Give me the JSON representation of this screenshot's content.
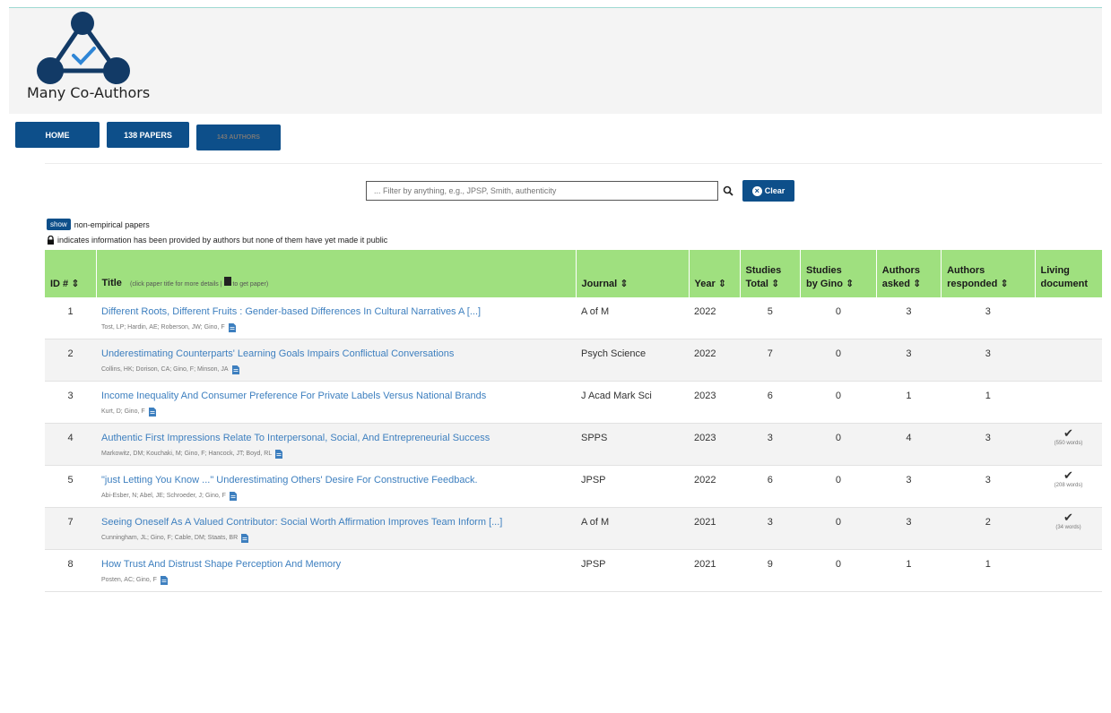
{
  "brand": {
    "name": "Many Co-Authors"
  },
  "nav": {
    "home": "HOME",
    "papers": "138 PAPERS",
    "authors": "143 AUTHORS"
  },
  "search": {
    "placeholder": "... Filter by anything, e.g., JPSP, Smith, authenticity",
    "clear_label": "Clear"
  },
  "filters": {
    "show_label": "show",
    "show_text": "non-empirical papers",
    "lock_text": "indicates information has been provided by authors but none of them have yet made it public"
  },
  "table": {
    "headers": {
      "id": "ID # ⇕",
      "title": "Title",
      "title_hint": "(click paper title for more details |",
      "title_hint2": "to get paper)",
      "journal": "Journal ⇕",
      "year": "Year ⇕",
      "studies_total_1": "Studies",
      "studies_total_2": "Total ⇕",
      "studies_gino_1": "Studies",
      "studies_gino_2": "by Gino ⇕",
      "authors_asked_1": "Authors",
      "authors_asked_2": "asked ⇕",
      "authors_resp_1": "Authors",
      "authors_resp_2": "responded ⇕",
      "living_1": "Living",
      "living_2": "document"
    },
    "rows": [
      {
        "id": "1",
        "title": "Different Roots, Different Fruits : Gender-based Differences In Cultural Narratives A [...]",
        "authors": "Tost, LP; Hardin, AE; Roberson, JW; Gino, F",
        "journal": "A of M",
        "year": "2022",
        "studies_total": "5",
        "studies_gino": "0",
        "asked": "3",
        "responded": "3",
        "living": "",
        "words": ""
      },
      {
        "id": "2",
        "title": "Underestimating Counterparts' Learning Goals Impairs Conflictual Conversations",
        "authors": "Collins, HK; Dorison, CA; Gino, F; Minson, JA",
        "journal": "Psych Science",
        "year": "2022",
        "studies_total": "7",
        "studies_gino": "0",
        "asked": "3",
        "responded": "3",
        "living": "",
        "words": ""
      },
      {
        "id": "3",
        "title": "Income Inequality And Consumer Preference For Private Labels Versus National Brands",
        "authors": "Kurt, D; Gino, F",
        "journal": "J Acad Mark Sci",
        "year": "2023",
        "studies_total": "6",
        "studies_gino": "0",
        "asked": "1",
        "responded": "1",
        "living": "",
        "words": ""
      },
      {
        "id": "4",
        "title": "Authentic First Impressions Relate To Interpersonal, Social, And Entrepreneurial Success",
        "authors": "Markowitz, DM; Kouchaki, M; Gino, F; Hancock, JT; Boyd, RL",
        "journal": "SPPS",
        "year": "2023",
        "studies_total": "3",
        "studies_gino": "0",
        "asked": "4",
        "responded": "3",
        "living": "✔",
        "words": "(550 words)"
      },
      {
        "id": "5",
        "title": "\"just Letting You Know ...\" Underestimating Others' Desire For Constructive Feedback.",
        "authors": "Abi-Esber, N; Abel, JE; Schroeder, J; Gino, F",
        "journal": "JPSP",
        "year": "2022",
        "studies_total": "6",
        "studies_gino": "0",
        "asked": "3",
        "responded": "3",
        "living": "✔",
        "words": "(208 words)"
      },
      {
        "id": "7",
        "title": "Seeing Oneself As A Valued Contributor: Social Worth Affirmation Improves Team Inform [...]",
        "authors": "Cunningham, JL; Gino, F; Cable, DM; Staats, BR",
        "journal": "A of M",
        "year": "2021",
        "studies_total": "3",
        "studies_gino": "0",
        "asked": "3",
        "responded": "2",
        "living": "✔",
        "words": "(34 words)"
      },
      {
        "id": "8",
        "title": "How Trust And Distrust Shape Perception And Memory",
        "authors": "Posten, AC; Gino, F",
        "journal": "JPSP",
        "year": "2021",
        "studies_total": "9",
        "studies_gino": "0",
        "asked": "1",
        "responded": "1",
        "living": "",
        "words": ""
      }
    ]
  },
  "colors": {
    "accent": "#0d4f8a",
    "header_bg": "#9fe07f",
    "link": "#3d7fbf"
  }
}
